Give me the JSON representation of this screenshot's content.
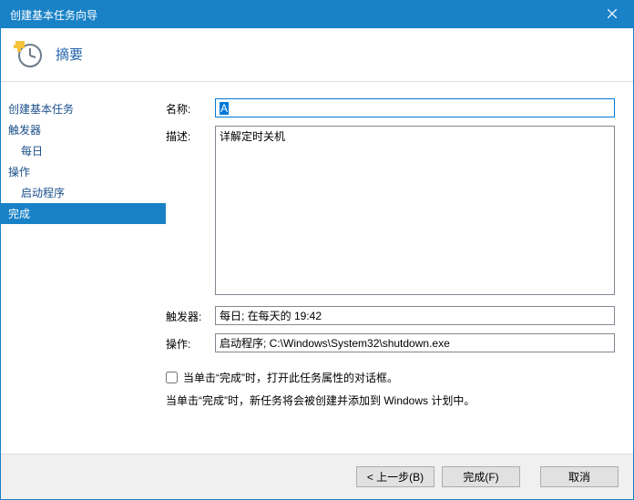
{
  "window": {
    "title": "创建基本任务向导"
  },
  "header": {
    "title": "摘要"
  },
  "sidebar": {
    "items": [
      {
        "label": "创建基本任务",
        "indent": false,
        "active": false
      },
      {
        "label": "触发器",
        "indent": false,
        "active": false
      },
      {
        "label": "每日",
        "indent": true,
        "active": false
      },
      {
        "label": "操作",
        "indent": false,
        "active": false
      },
      {
        "label": "启动程序",
        "indent": true,
        "active": false
      },
      {
        "label": "完成",
        "indent": false,
        "active": true
      }
    ]
  },
  "form": {
    "labels": {
      "name": "名称:",
      "description": "描述:",
      "trigger": "触发器:",
      "action": "操作:"
    },
    "values": {
      "name": "A",
      "description": "详解定时关机",
      "trigger": "每日; 在每天的 19:42",
      "action": "启动程序; C:\\Windows\\System32\\shutdown.exe"
    }
  },
  "options": {
    "open_properties_label": "当单击“完成”时，打开此任务属性的对话框。",
    "hint": "当单击“完成”时，新任务将会被创建并添加到 Windows 计划中。"
  },
  "buttons": {
    "back": "< 上一步(B)",
    "finish": "完成(F)",
    "cancel": "取消"
  }
}
